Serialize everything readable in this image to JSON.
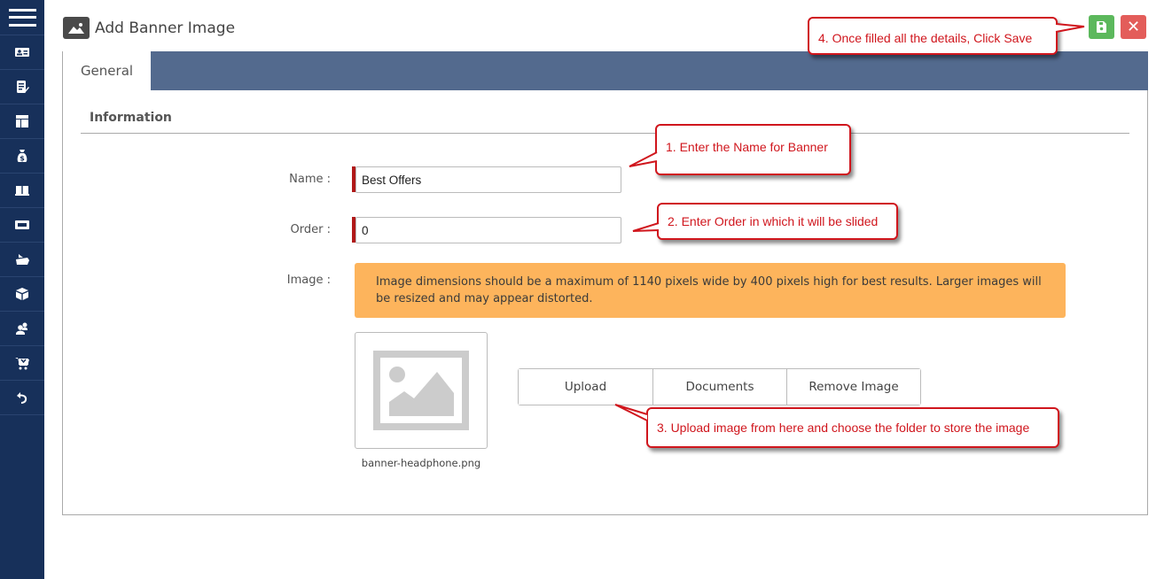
{
  "sidebar": {
    "menu_icon": "hamburger-menu-icon",
    "items": [
      {
        "icon": "id-card-icon"
      },
      {
        "icon": "edit-list-icon"
      },
      {
        "icon": "layout-icon"
      },
      {
        "icon": "money-bag-icon"
      },
      {
        "icon": "book-icon"
      },
      {
        "icon": "ticket-icon"
      },
      {
        "icon": "ship-icon"
      },
      {
        "icon": "box-icon"
      },
      {
        "icon": "users-icon"
      },
      {
        "icon": "cart-icon"
      },
      {
        "icon": "undo-icon"
      }
    ]
  },
  "header": {
    "title": "Add Banner Image",
    "title_icon": "image-icon",
    "save_icon": "save-icon",
    "close_icon": "close-icon",
    "close_glyph": "✕"
  },
  "tabs": [
    {
      "label": "General",
      "active": true
    }
  ],
  "section": {
    "title": "Information"
  },
  "form": {
    "name_label": "Name :",
    "name_value": "Best Offers",
    "order_label": "Order :",
    "order_value": "0",
    "image_label": "Image :",
    "warning": "Image dimensions should be a maximum of 1140 pixels wide by 400 pixels high for best results. Larger images will be resized and may appear distorted.",
    "filename": "banner-headphone.png",
    "buttons": {
      "upload": "Upload",
      "documents": "Documents",
      "remove": "Remove Image"
    }
  },
  "callouts": {
    "step1": "1.  Enter the Name for Banner",
    "step2": "2. Enter Order in which it will be slided",
    "step3": "3. Upload image from here and choose the folder to store the image",
    "step4": "4. Once filled all the details, Click Save"
  },
  "colors": {
    "sidebar": "#17305a",
    "tabbar": "#536a8e",
    "warning": "#fdb45c",
    "save": "#5cb85c",
    "close": "#e35d5a",
    "required": "#b01919",
    "callout": "#d0161d"
  }
}
